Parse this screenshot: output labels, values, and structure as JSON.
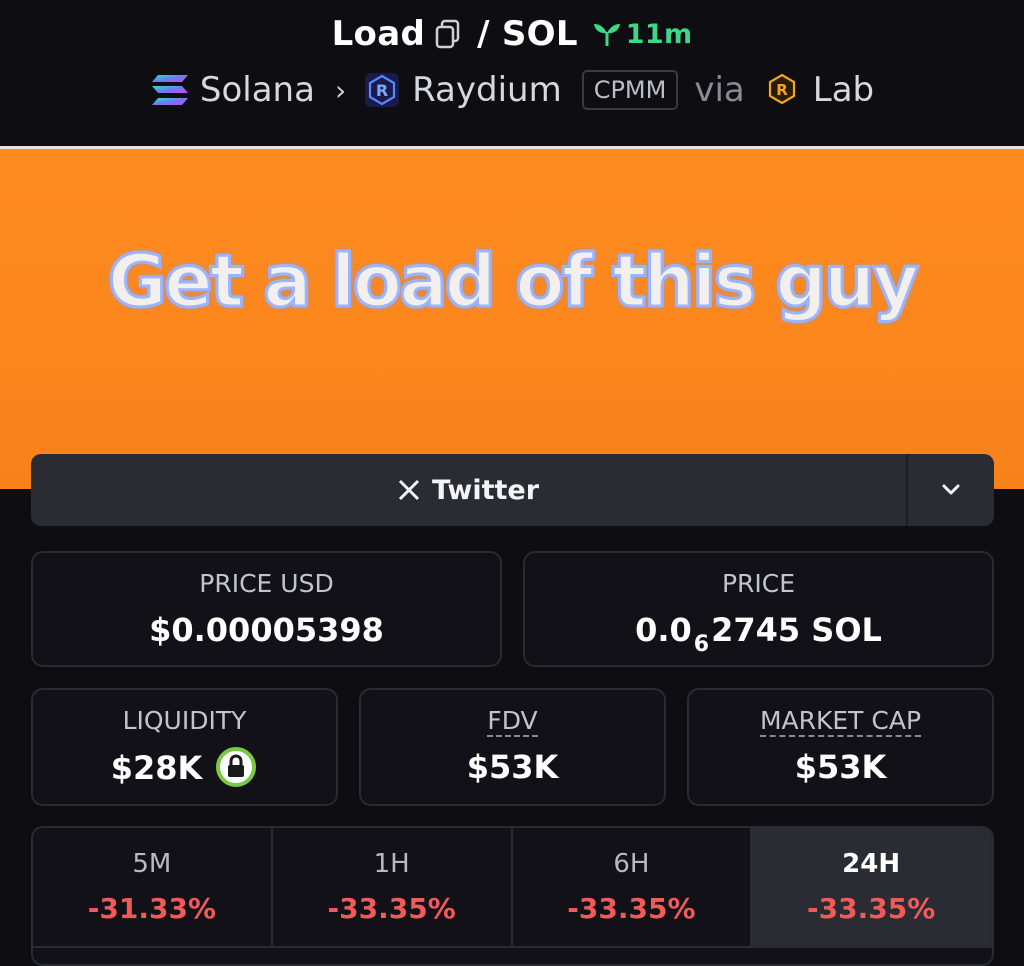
{
  "header": {
    "token": "Load",
    "separator": "/",
    "quote": "SOL",
    "age": "11m",
    "chain": "Solana",
    "dex": "Raydium",
    "pool_type": "CPMM",
    "via": "via",
    "launchpad": "Lab",
    "icons": [
      "copy-icon",
      "sprout-icon",
      "solana-logo",
      "raydium-logo",
      "chevron-right-icon",
      "lab-logo"
    ]
  },
  "banner": {
    "text": "Get a load of this guy",
    "background": "#f7821a"
  },
  "social": {
    "label": "Twitter",
    "icons": [
      "x-logo-icon",
      "chevron-down-icon"
    ]
  },
  "stats": {
    "price_usd": {
      "label": "PRICE USD",
      "value": "$0.00005398"
    },
    "price": {
      "label": "PRICE",
      "prefix": "0.0",
      "zeros": "6",
      "digits": "2745 SOL"
    },
    "liquidity": {
      "label": "LIQUIDITY",
      "value": "$28K"
    },
    "fdv": {
      "label": "FDV",
      "value": "$53K"
    },
    "market_cap": {
      "label": "MARKET CAP",
      "value": "$53K"
    }
  },
  "timeframes": [
    {
      "period": "5M",
      "change": "-31.33%"
    },
    {
      "period": "1H",
      "change": "-33.35%"
    },
    {
      "period": "6H",
      "change": "-33.35%"
    },
    {
      "period": "24H",
      "change": "-33.35%",
      "active": true
    }
  ],
  "colors": {
    "accent_green": "#3fd686",
    "negative_red": "#f25a5a",
    "lock_green": "#7ac943",
    "background": "#0d0d12"
  }
}
